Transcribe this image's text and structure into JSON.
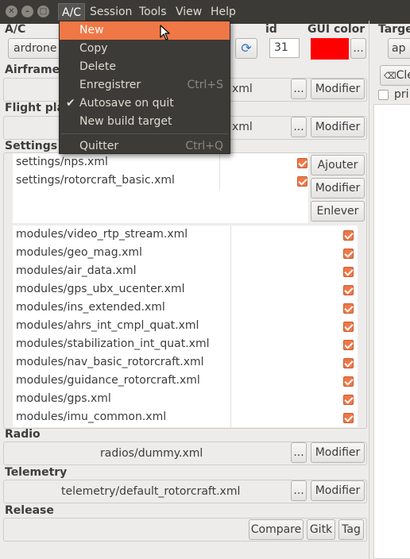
{
  "menubar": {
    "menus": [
      "A/C",
      "Session",
      "Tools",
      "View",
      "Help"
    ],
    "window_buttons": [
      "✕",
      "–",
      "□"
    ]
  },
  "ac_menu": {
    "items": [
      {
        "label": "New",
        "shortcut": ""
      },
      {
        "label": "Copy",
        "shortcut": ""
      },
      {
        "label": "Delete",
        "shortcut": ""
      },
      {
        "label": "Enregistrer",
        "shortcut": "Ctrl+S"
      },
      {
        "label": "Autosave on quit",
        "shortcut": "",
        "checked": true
      },
      {
        "label": "New build target",
        "shortcut": ""
      },
      {
        "label": "Quitter",
        "shortcut": "Ctrl+Q"
      }
    ],
    "check_mark": "✔"
  },
  "ac": {
    "label": "A/C",
    "selected": "ardrone",
    "id_label": "id",
    "id_value": "31",
    "gui_color_label": "GUI color",
    "gui_color": "#ff0000",
    "ellipsis": "..."
  },
  "target": {
    "label": "Targe",
    "selected": "ap",
    "clean_label": "Cle",
    "print_label": "pri"
  },
  "airframe": {
    "label": "Airframe",
    "file_suffix": "xml",
    "edit_label": "Modifier",
    "ellipsis": "..."
  },
  "flight_plan": {
    "label": "Flight pla",
    "file_suffix": "xml",
    "edit_label": "Modifier",
    "ellipsis": "..."
  },
  "settings": {
    "label": "Settings",
    "items": [
      "settings/nps.xml",
      "settings/rotorcraft_basic.xml"
    ],
    "add_label": "Ajouter",
    "edit_label": "Modifier",
    "remove_label": "Enlever"
  },
  "modules": {
    "items": [
      "modules/video_rtp_stream.xml",
      "modules/geo_mag.xml",
      "modules/air_data.xml",
      "modules/gps_ubx_ucenter.xml",
      "modules/ins_extended.xml",
      "modules/ahrs_int_cmpl_quat.xml",
      "modules/stabilization_int_quat.xml",
      "modules/nav_basic_rotorcraft.xml",
      "modules/guidance_rotorcraft.xml",
      "modules/gps.xml",
      "modules/imu_common.xml"
    ]
  },
  "radio": {
    "label": "Radio",
    "file": "radios/dummy.xml",
    "edit_label": "Modifier",
    "ellipsis": "..."
  },
  "telemetry": {
    "label": "Telemetry",
    "file": "telemetry/default_rotorcraft.xml",
    "edit_label": "Modifier",
    "ellipsis": "..."
  },
  "release": {
    "label": "Release",
    "compare_label": "Compare",
    "gitk_label": "Gitk",
    "tag_label": "Tag"
  },
  "colors": {
    "accent": "#f07746",
    "menubar": "#3b3a36",
    "gui_color": "#ff0000"
  }
}
